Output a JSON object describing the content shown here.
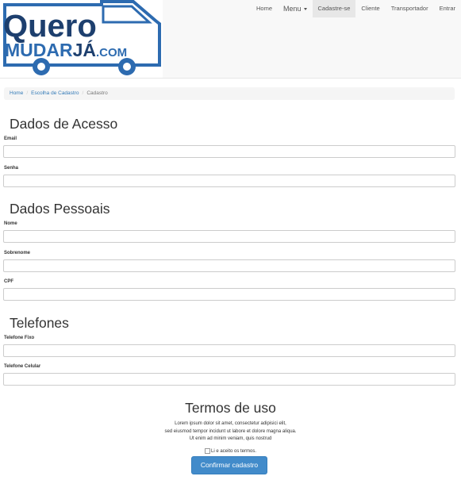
{
  "logo": {
    "line1": "Quero",
    "line2_part1": "MUDAR",
    "line2_part2": "JÁ",
    "line2_part3": ".COM"
  },
  "nav": {
    "home": "Home",
    "menu": "Menu",
    "cadastre": "Cadastre-se",
    "cliente": "Cliente",
    "transportador": "Transportador",
    "entrar": "Entrar"
  },
  "breadcrumb": {
    "home": "Home",
    "escolha": "Escolha de Cadastro",
    "current": "Cadastro"
  },
  "sections": {
    "acesso": "Dados de Acesso",
    "pessoais": "Dados Pessoais",
    "telefones": "Telefones"
  },
  "fields": {
    "email": "Email",
    "senha": "Senha",
    "nome": "Nome",
    "sobrenome": "Sobrenome",
    "cpf": "CPF",
    "telefone_fixo": "Telefone Fixo",
    "telefone_celular": "Telefone Celular"
  },
  "terms": {
    "title": "Termos de uso",
    "line1": "Lorem ipsum dolor sit amet, consectetur adipisici elit,",
    "line2": "sed eiusmod tempor incidunt ut labore et dolore magna aliqua.",
    "line3": "Ut enim ad minim veniam, quis nostrud",
    "agree": "Li e aceito os termos.",
    "submit": "Confirmar cadastro"
  },
  "colors": {
    "logo_blue": "#2d6bb0",
    "logo_dark": "#1d3f6e",
    "button": "#428bca"
  }
}
